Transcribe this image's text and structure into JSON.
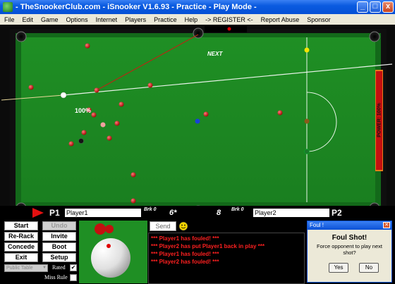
{
  "window": {
    "title": "- TheSnookerClub.com - iSnooker V1.6.93 - Practice - Play Mode -",
    "min_label": "_",
    "max_label": "□",
    "close_label": "x"
  },
  "menu": [
    "File",
    "Edit",
    "Game",
    "Options",
    "Internet",
    "Players",
    "Practice",
    "Help",
    "-> REGISTER <-",
    "Report Abuse",
    "Sponsor"
  ],
  "table": {
    "next_label": "NEXT",
    "aim_percent": "100%",
    "power_label": "POWER: 100%",
    "power_level": 1.0
  },
  "scoreboard": {
    "p1_tag": "P1",
    "p1_name": "Player1",
    "p1_brk_label": "Brk 0",
    "p1_score": "6*",
    "p2_score": "8",
    "p2_brk_label": "Brk 0",
    "p2_name": "Player2",
    "p2_tag": "P2"
  },
  "controls": {
    "start": "Start",
    "undo": "Undo",
    "rerack": "Re-Rack",
    "invite": "Invite",
    "concede": "Concede",
    "boot": "Boot",
    "exit": "Exit",
    "setup": "Setup",
    "table_type": "Public Table",
    "rated_label": "Rated",
    "miss_rule_label": "Miss Rule",
    "rated_checked": true,
    "miss_rule_checked": false
  },
  "chat": {
    "send_label": "Send",
    "messages": [
      "*** Player1 has fouled! ***",
      "*** Player2 has put Player1 back in play ***",
      "*** Player1 has fouled! ***",
      "*** Player2 has fouled! ***"
    ]
  },
  "dialog": {
    "title": "Foul !",
    "heading": "Foul Shot!",
    "message": "Force opponent to play next shot?",
    "yes": "Yes",
    "no": "No"
  }
}
